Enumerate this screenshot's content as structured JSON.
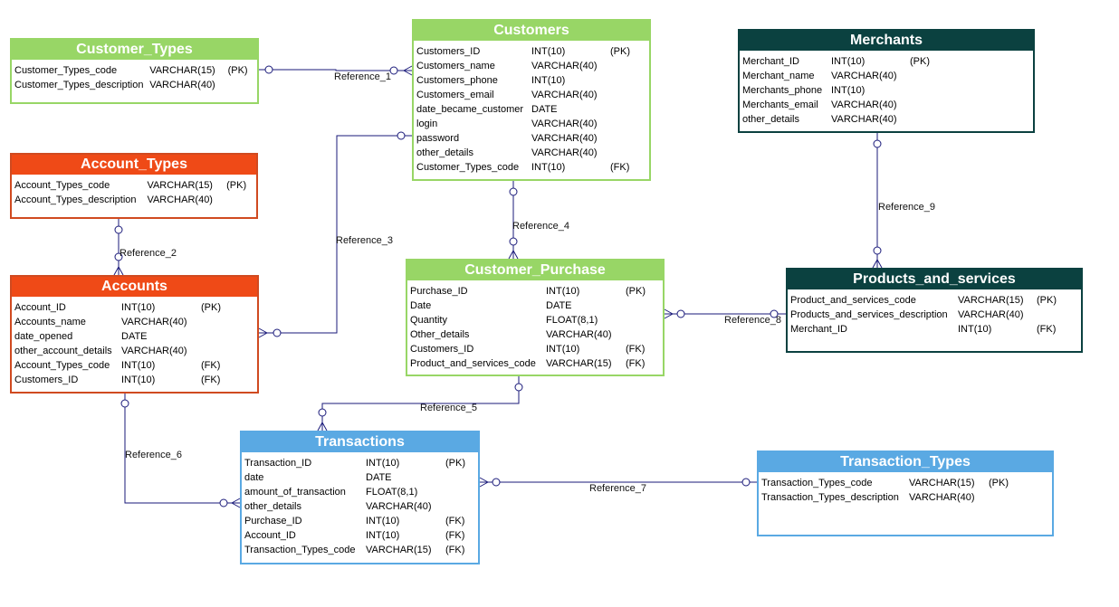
{
  "colors": {
    "green": "#98d666",
    "orange": "#ef4a17",
    "dark_teal": "#0b4140",
    "blue": "#5aa9e3",
    "line": "#1a1a7a"
  },
  "entities": {
    "customer_types": {
      "title": "Customer_Types",
      "rows": [
        {
          "name": "Customer_Types_code",
          "type": "VARCHAR(15)",
          "key": "(PK)"
        },
        {
          "name": "Customer_Types_description",
          "type": "VARCHAR(40)",
          "key": ""
        }
      ]
    },
    "customers": {
      "title": "Customers",
      "rows": [
        {
          "name": "Customers_ID",
          "type": "INT(10)",
          "key": "(PK)"
        },
        {
          "name": "Customers_name",
          "type": "VARCHAR(40)",
          "key": ""
        },
        {
          "name": "Customers_phone",
          "type": "INT(10)",
          "key": ""
        },
        {
          "name": "Customers_email",
          "type": "VARCHAR(40)",
          "key": ""
        },
        {
          "name": "date_became_customer",
          "type": "DATE",
          "key": ""
        },
        {
          "name": "login",
          "type": "VARCHAR(40)",
          "key": ""
        },
        {
          "name": "password",
          "type": "VARCHAR(40)",
          "key": ""
        },
        {
          "name": "other_details",
          "type": "VARCHAR(40)",
          "key": ""
        },
        {
          "name": "Customer_Types_code",
          "type": "INT(10)",
          "key": "(FK)"
        }
      ]
    },
    "merchants": {
      "title": "Merchants",
      "rows": [
        {
          "name": "Merchant_ID",
          "type": "INT(10)",
          "key": "(PK)"
        },
        {
          "name": "Merchant_name",
          "type": "VARCHAR(40)",
          "key": ""
        },
        {
          "name": "Merchants_phone",
          "type": "INT(10)",
          "key": ""
        },
        {
          "name": "Merchants_email",
          "type": "VARCHAR(40)",
          "key": ""
        },
        {
          "name": "other_details",
          "type": "VARCHAR(40)",
          "key": ""
        }
      ]
    },
    "account_types": {
      "title": "Account_Types",
      "rows": [
        {
          "name": "Account_Types_code",
          "type": "VARCHAR(15)",
          "key": "(PK)"
        },
        {
          "name": "Account_Types_description",
          "type": "VARCHAR(40)",
          "key": ""
        }
      ]
    },
    "accounts": {
      "title": "Accounts",
      "rows": [
        {
          "name": "Account_ID",
          "type": "INT(10)",
          "key": "(PK)"
        },
        {
          "name": "Accounts_name",
          "type": "VARCHAR(40)",
          "key": ""
        },
        {
          "name": "date_opened",
          "type": "DATE",
          "key": ""
        },
        {
          "name": "other_account_details",
          "type": "VARCHAR(40)",
          "key": ""
        },
        {
          "name": "Account_Types_code",
          "type": "INT(10)",
          "key": "(FK)"
        },
        {
          "name": "Customers_ID",
          "type": "INT(10)",
          "key": "(FK)"
        }
      ]
    },
    "customer_purchase": {
      "title": "Customer_Purchase",
      "rows": [
        {
          "name": "Purchase_ID",
          "type": "INT(10)",
          "key": "(PK)"
        },
        {
          "name": "Date",
          "type": "DATE",
          "key": ""
        },
        {
          "name": "Quantity",
          "type": "FLOAT(8,1)",
          "key": ""
        },
        {
          "name": "Other_details",
          "type": "VARCHAR(40)",
          "key": ""
        },
        {
          "name": "Customers_ID",
          "type": "INT(10)",
          "key": "(FK)"
        },
        {
          "name": "Product_and_services_code",
          "type": "VARCHAR(15)",
          "key": "(FK)"
        }
      ]
    },
    "products_and_services": {
      "title": "Products_and_services",
      "rows": [
        {
          "name": "Product_and_services_code",
          "type": "VARCHAR(15)",
          "key": "(PK)"
        },
        {
          "name": "Products_and_services_description",
          "type": "VARCHAR(40)",
          "key": ""
        },
        {
          "name": "Merchant_ID",
          "type": "INT(10)",
          "key": "(FK)"
        }
      ]
    },
    "transactions": {
      "title": "Transactions",
      "rows": [
        {
          "name": "Transaction_ID",
          "type": "INT(10)",
          "key": "(PK)"
        },
        {
          "name": "date",
          "type": "DATE",
          "key": ""
        },
        {
          "name": "amount_of_transaction",
          "type": "FLOAT(8,1)",
          "key": ""
        },
        {
          "name": "other_details",
          "type": "VARCHAR(40)",
          "key": ""
        },
        {
          "name": "Purchase_ID",
          "type": "INT(10)",
          "key": "(FK)"
        },
        {
          "name": "Account_ID",
          "type": "INT(10)",
          "key": "(FK)"
        },
        {
          "name": "Transaction_Types_code",
          "type": "VARCHAR(15)",
          "key": "(FK)"
        }
      ]
    },
    "transaction_types": {
      "title": "Transaction_Types",
      "rows": [
        {
          "name": "Transaction_Types_code",
          "type": "VARCHAR(15)",
          "key": "(PK)"
        },
        {
          "name": "Transaction_Types_description",
          "type": "VARCHAR(40)",
          "key": ""
        }
      ]
    }
  },
  "references": [
    {
      "label": "Reference_1",
      "from": "Customer_Types",
      "to": "Customers"
    },
    {
      "label": "Reference_2",
      "from": "Account_Types",
      "to": "Accounts"
    },
    {
      "label": "Reference_3",
      "from": "Customers",
      "to": "Accounts"
    },
    {
      "label": "Reference_4",
      "from": "Customers",
      "to": "Customer_Purchase"
    },
    {
      "label": "Reference_5",
      "from": "Customer_Purchase",
      "to": "Transactions"
    },
    {
      "label": "Reference_6",
      "from": "Accounts",
      "to": "Transactions"
    },
    {
      "label": "Reference_7",
      "from": "Transaction_Types",
      "to": "Transactions"
    },
    {
      "label": "Reference_8",
      "from": "Products_and_services",
      "to": "Customer_Purchase"
    },
    {
      "label": "Reference_9",
      "from": "Merchants",
      "to": "Products_and_services"
    }
  ]
}
